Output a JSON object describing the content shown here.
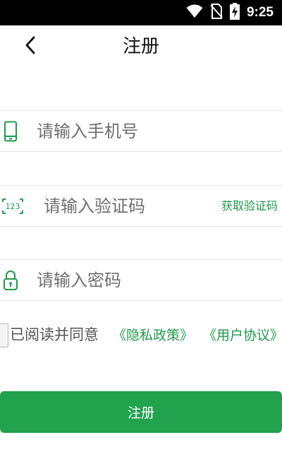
{
  "status_bar": {
    "time": "9:25",
    "icons": [
      "wifi-icon",
      "no-sim-icon",
      "battery-charging-icon"
    ]
  },
  "header": {
    "title": "注册",
    "back_icon": "chevron-left-icon"
  },
  "form": {
    "phone": {
      "placeholder": "请输入手机号",
      "value": "",
      "icon": "phone-icon"
    },
    "code": {
      "placeholder": "请输入验证码",
      "value": "",
      "icon": "code-123-icon",
      "get_code_label": "获取验证码"
    },
    "password": {
      "placeholder": "请输入密码",
      "value": "",
      "icon": "lock-icon"
    }
  },
  "agreement": {
    "checked": false,
    "prefix": "已阅读并同意",
    "privacy_link": "《隐私政策》",
    "user_link": "《用户协议》"
  },
  "submit": {
    "label": "注册"
  },
  "colors": {
    "accent": "#22a24d",
    "link": "#1e9a49",
    "status_bar": "#000000"
  }
}
